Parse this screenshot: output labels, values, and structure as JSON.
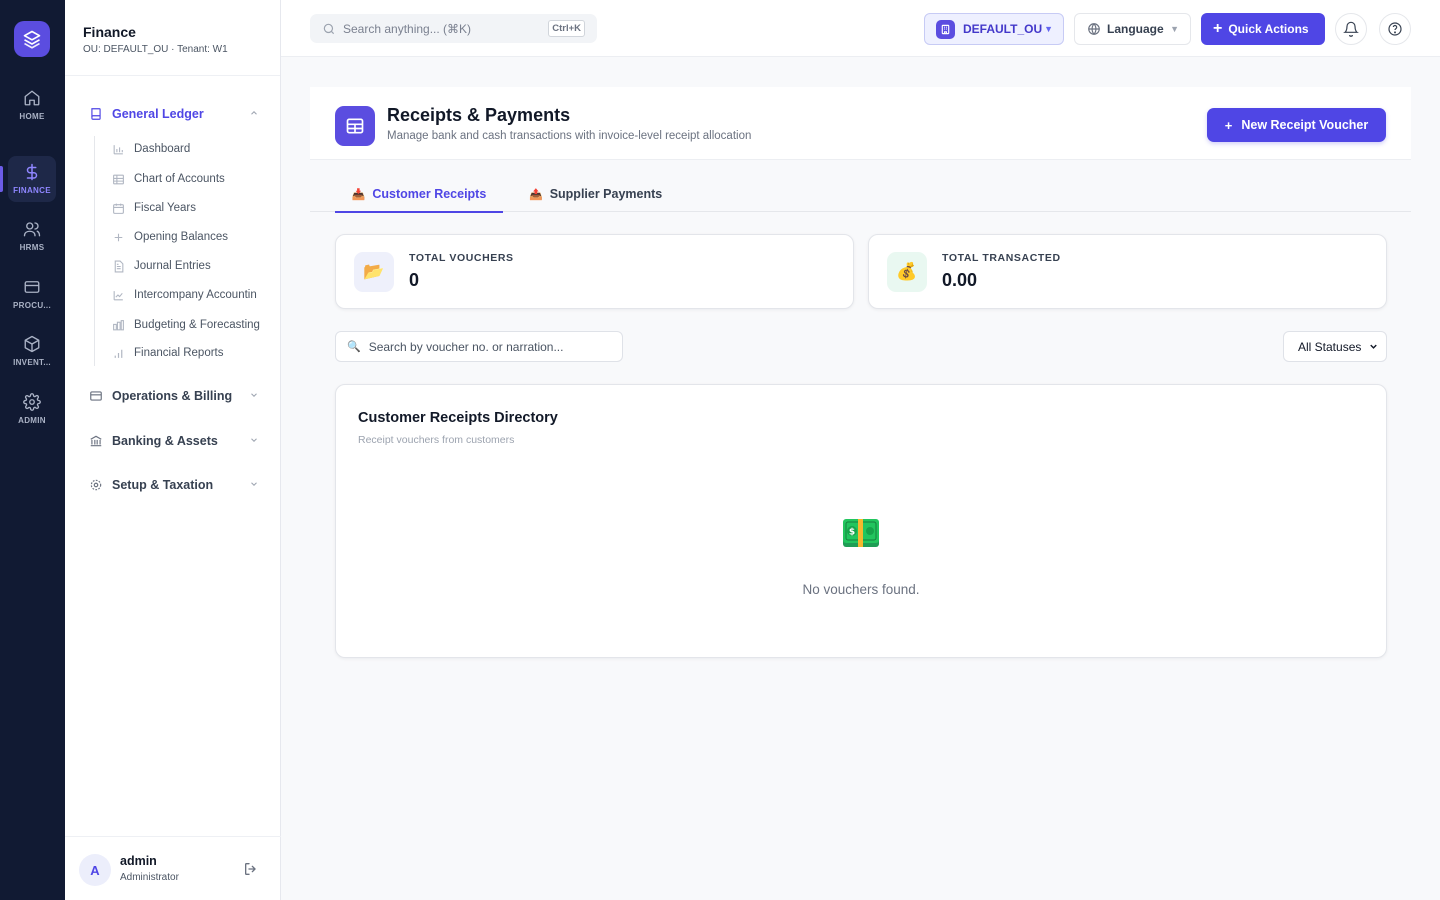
{
  "rail": {
    "items": [
      {
        "label": "HOME",
        "icon": "home-icon"
      },
      {
        "label": "FINANCE",
        "icon": "dollar-icon",
        "active": true
      },
      {
        "label": "HRMS",
        "icon": "users-icon"
      },
      {
        "label": "PROCU...",
        "icon": "card-icon"
      },
      {
        "label": "INVENT...",
        "icon": "box-icon"
      },
      {
        "label": "ADMIN",
        "icon": "gear-icon"
      }
    ]
  },
  "sidebar": {
    "title": "Finance",
    "subtitle": "OU: DEFAULT_OU · Tenant: W1",
    "sections": [
      {
        "label": "General Ledger",
        "icon": "book-icon",
        "open": true
      },
      {
        "label": "Operations & Billing",
        "icon": "card-icon"
      },
      {
        "label": "Banking & Assets",
        "icon": "bank-icon"
      },
      {
        "label": "Setup & Taxation",
        "icon": "gear-icon"
      }
    ],
    "gl_items": [
      {
        "label": "Dashboard",
        "icon": "bar-chart-icon"
      },
      {
        "label": "Chart of Accounts",
        "icon": "table-icon"
      },
      {
        "label": "Fiscal Years",
        "icon": "calendar-icon"
      },
      {
        "label": "Opening Balances",
        "icon": "plus-icon"
      },
      {
        "label": "Journal Entries",
        "icon": "file-icon"
      },
      {
        "label": "Intercompany Accountin",
        "icon": "line-chart-icon"
      },
      {
        "label": "Budgeting & Forecasting",
        "icon": "budget-icon"
      },
      {
        "label": "Financial Reports",
        "icon": "signal-icon"
      }
    ],
    "user": {
      "initial": "A",
      "name": "admin",
      "role": "Administrator"
    }
  },
  "topbar": {
    "search_placeholder": "Search anything... (⌘K)",
    "shortcut": "Ctrl+K",
    "ou_label": "DEFAULT_OU",
    "language_label": "Language",
    "quick_actions_label": "Quick Actions"
  },
  "page": {
    "title": "Receipts & Payments",
    "subtitle": "Manage bank and cash transactions with invoice-level receipt allocation",
    "new_button_label": "New Receipt Voucher",
    "tabs": [
      {
        "label": "Customer Receipts",
        "icon": "📥",
        "active": true
      },
      {
        "label": "Supplier Payments",
        "icon": "📤"
      }
    ],
    "stats": [
      {
        "label": "TOTAL VOUCHERS",
        "value": "0",
        "icon": "📂"
      },
      {
        "label": "TOTAL TRANSACTED",
        "value": "0.00",
        "icon": "💰"
      }
    ],
    "filter_placeholder": "Search by voucher no. or narration...",
    "status_selected": "All Statuses",
    "directory": {
      "title": "Customer Receipts Directory",
      "subtitle": "Receipt vouchers from customers",
      "empty_text": "No vouchers found.",
      "empty_icon": "money-icon"
    }
  },
  "colors": {
    "accent": "#4f46e5",
    "rail_bg": "#111a33"
  }
}
